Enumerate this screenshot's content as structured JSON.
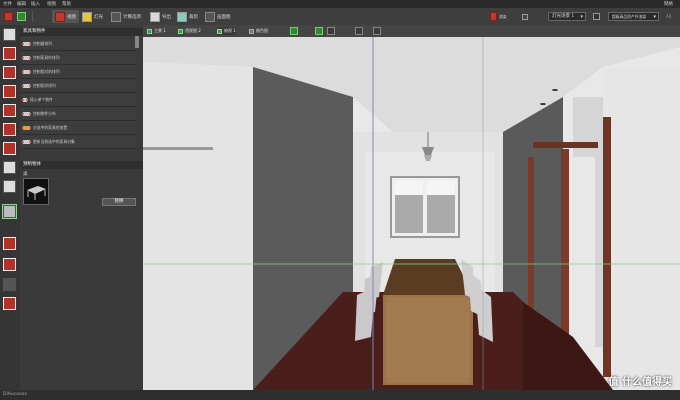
{
  "app": {
    "menu": [
      "文件",
      "编辑",
      "插入",
      "视图",
      "帮助"
    ],
    "right_menu": "网格"
  },
  "toolbar": {
    "buttons": [
      {
        "label": "视图",
        "icon": "view-icon"
      },
      {
        "label": "灯光",
        "icon": "light-icon"
      },
      {
        "label": "计算选项",
        "icon": "compute-icon"
      },
      {
        "label": "导出",
        "icon": "export-icon"
      },
      {
        "label": "裁剪",
        "icon": "crop-icon"
      },
      {
        "label": "画面图",
        "icon": "image-icon"
      }
    ],
    "render_button": "渲染",
    "light_dropdown": "灯光场景 1",
    "quality_dropdown": "超级高品质产外渲染",
    "right_label": "AR"
  },
  "panel": {
    "title": "家具和物件",
    "items": [
      "控制器排列",
      "控制家具的排列",
      "控制相对的排列",
      "控制相邻排列",
      "插入单个物件",
      "控制物件分布",
      "对选中的家具的放置",
      "更新当前选中的家具对象"
    ],
    "section_title": "预制物体",
    "section_sub": "桌",
    "select_button": "替换"
  },
  "viewport_toolbar": {
    "tabs": [
      "主景 1",
      "透视图 2",
      "俯视 1",
      "颜色图"
    ],
    "icons": [
      "grid-icon",
      "render-icon",
      "eye-icon",
      "expand-icon",
      "move-icon"
    ]
  },
  "status": {
    "left": "DiAucanxx"
  },
  "watermark": "值 什么值得买"
}
